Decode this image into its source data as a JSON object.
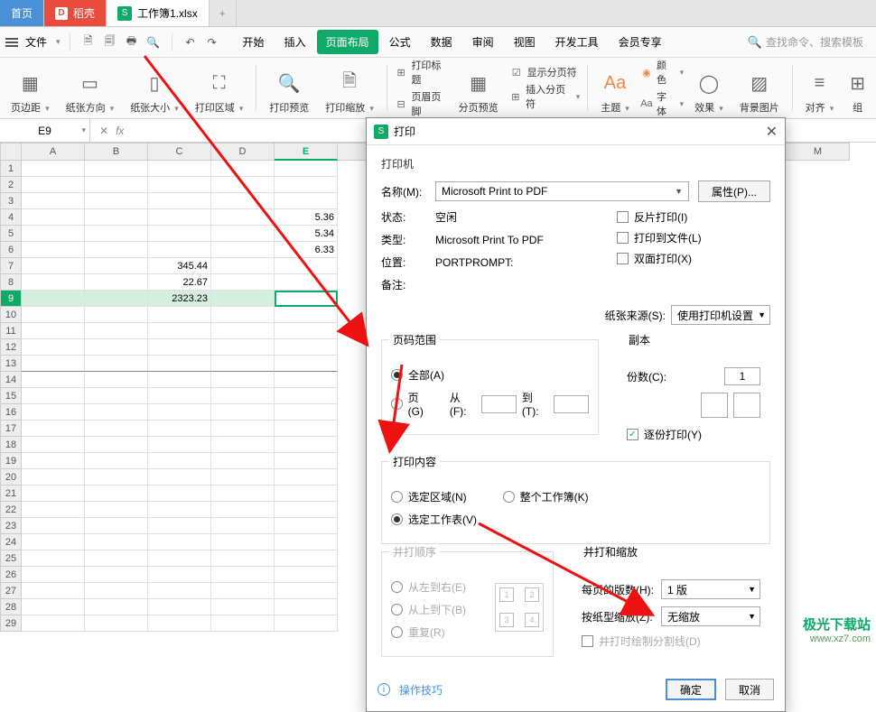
{
  "tabs": {
    "home": "首页",
    "daoke": "稻壳",
    "file": "工作簿1.xlsx",
    "add": "+"
  },
  "menubar": {
    "file": "文件",
    "mtabs": [
      "开始",
      "插入",
      "页面布局",
      "公式",
      "数据",
      "审阅",
      "视图",
      "开发工具",
      "会员专享"
    ],
    "active": "页面布局",
    "search_placeholder": "查找命令、搜索模板"
  },
  "ribbon": {
    "g1": "页边距",
    "g2": "纸张方向",
    "g3": "纸张大小",
    "g4": "打印区域",
    "g5": "打印预览",
    "g6": "打印缩放",
    "st1a": "打印标题",
    "st1b": "页眉页脚",
    "g7": "分页预览",
    "st2a": "显示分页符",
    "st2b": "插入分页符",
    "g8": "主题",
    "st3a": "颜色",
    "st3b": "字体",
    "g9": "效果",
    "g10": "背景图片",
    "g11": "对齐",
    "g12": "组"
  },
  "fxbar": {
    "cellref": "E9"
  },
  "columns": [
    "A",
    "B",
    "C",
    "D",
    "E",
    "M"
  ],
  "cells": {
    "E4": "5.36",
    "E5": "5.34",
    "E6": "6.33",
    "C7": "345.44",
    "C8": "22.67",
    "C9": "2323.23"
  },
  "dlg": {
    "title": "打印",
    "printer_section": "打印机",
    "name_label": "名称(M):",
    "name_value": "Microsoft Print to PDF",
    "props_btn": "属性(P)...",
    "status_label": "状态:",
    "status_value": "空闲",
    "type_label": "类型:",
    "type_value": "Microsoft Print To PDF",
    "where_label": "位置:",
    "where_value": "PORTPROMPT:",
    "comment_label": "备注:",
    "chk_reverse": "反片打印(I)",
    "chk_tofile": "打印到文件(L)",
    "chk_duplex": "双面打印(X)",
    "paper_src_label": "纸张来源(S):",
    "paper_src_value": "使用打印机设置",
    "range_legend": "页码范围",
    "range_all": "全部(A)",
    "range_pages": "页(G)",
    "from": "从(F):",
    "to": "到(T):",
    "copies_legend": "副本",
    "copies_label": "份数(C):",
    "copies_value": "1",
    "collate": "逐份打印(Y)",
    "content_legend": "打印内容",
    "sel_area": "选定区域(N)",
    "whole": "整个工作簿(K)",
    "sel_sheet": "选定工作表(V)",
    "order_legend": "并打顺序",
    "o1": "从左到右(E)",
    "o2": "从上到下(B)",
    "o3": "重复(R)",
    "zoom_legend": "并打和缩放",
    "perpage": "每页的版数(H):",
    "perpage_v": "1 版",
    "scale": "按纸型缩放(Z):",
    "scale_v": "无缩放",
    "borderchk": "并打时绘制分割线(D)",
    "tips": "操作技巧",
    "ok": "确定",
    "cancel": "取消"
  },
  "watermark": {
    "l1": "极光下载站",
    "l2": "www.xz7.com"
  }
}
